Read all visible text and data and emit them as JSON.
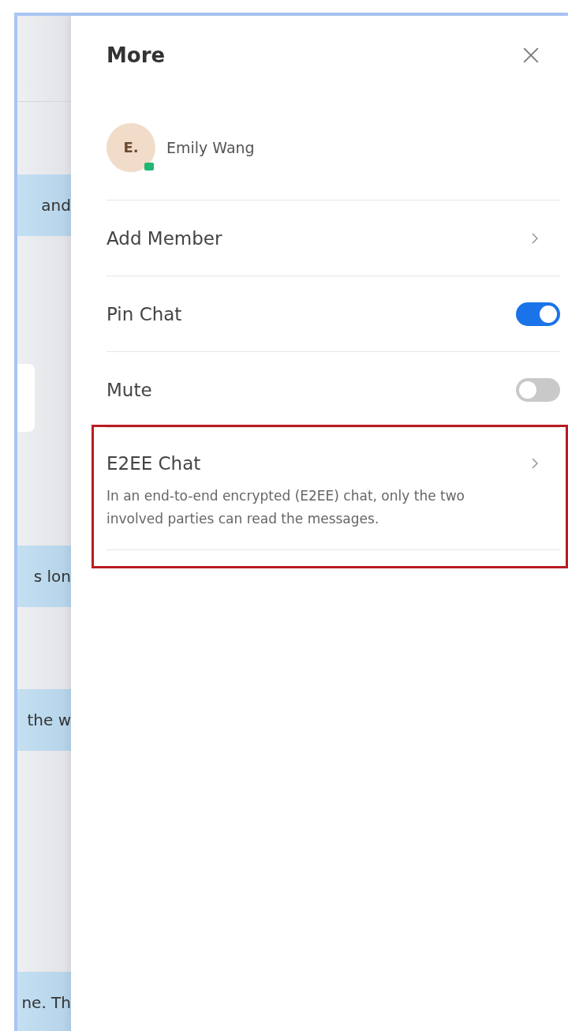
{
  "background_chat": {
    "bubbles": [
      {
        "text": "and",
        "kind": "own"
      },
      {
        "kind": "other"
      },
      {
        "text": "s lon",
        "kind": "own"
      },
      {
        "text": "the w",
        "kind": "own"
      },
      {
        "text": "ne. Th",
        "kind": "own"
      }
    ]
  },
  "panel": {
    "title": "More",
    "contact": {
      "initials": "E.",
      "name": "Emily Wang",
      "online": true
    },
    "items": [
      {
        "kind": "link",
        "label": "Add Member",
        "highlighted": false
      },
      {
        "kind": "toggle",
        "label": "Pin Chat",
        "on": true,
        "highlighted": false
      },
      {
        "kind": "toggle",
        "label": "Mute",
        "on": false,
        "highlighted": false
      },
      {
        "kind": "link",
        "label": "E2EE Chat",
        "description": "In an end-to-end encrypted (E2EE) chat, only the two involved parties can read the messages.",
        "highlighted": true
      }
    ]
  }
}
